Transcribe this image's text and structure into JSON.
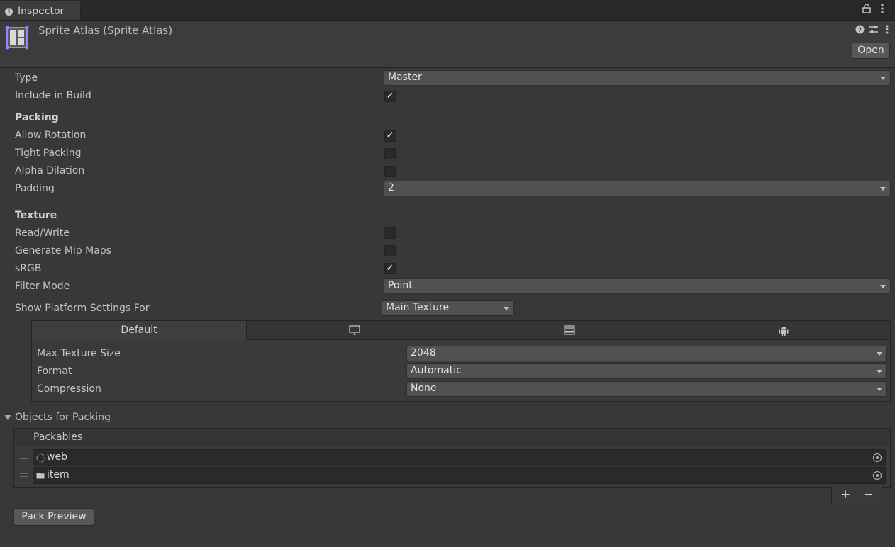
{
  "window": {
    "tab_label": "Inspector",
    "tab_icon": "info-icon",
    "lock_icon": "lock-icon",
    "menu_icon": "kebab-menu-icon"
  },
  "header": {
    "asset_title": "Sprite Atlas (Sprite Atlas)",
    "asset_icon": "sprite-atlas-icon",
    "open_button": "Open",
    "help_icon": "help-icon",
    "preset_icon": "preset-icon",
    "menu_icon": "kebab-menu-icon"
  },
  "fields": {
    "type": {
      "label": "Type",
      "value": "Master"
    },
    "include_in_build": {
      "label": "Include in Build",
      "checked": true
    },
    "packing_header": "Packing",
    "allow_rotation": {
      "label": "Allow Rotation",
      "checked": true
    },
    "tight_packing": {
      "label": "Tight Packing",
      "checked": false
    },
    "alpha_dilation": {
      "label": "Alpha Dilation",
      "checked": false
    },
    "padding": {
      "label": "Padding",
      "value": "2"
    },
    "texture_header": "Texture",
    "read_write": {
      "label": "Read/Write",
      "checked": false
    },
    "generate_mip_maps": {
      "label": "Generate Mip Maps",
      "checked": false
    },
    "srgb": {
      "label": "sRGB",
      "checked": true
    },
    "filter_mode": {
      "label": "Filter Mode",
      "value": "Point"
    },
    "platform_settings_for": {
      "label": "Show Platform Settings For",
      "value": "Main Texture"
    }
  },
  "platform_tabs": [
    {
      "label": "Default",
      "icon": ""
    },
    {
      "label": "",
      "icon": "monitor-icon"
    },
    {
      "label": "",
      "icon": "server-icon"
    },
    {
      "label": "",
      "icon": "android-icon"
    }
  ],
  "platform_settings": {
    "max_texture_size": {
      "label": "Max Texture Size",
      "value": "2048"
    },
    "format": {
      "label": "Format",
      "value": "Automatic"
    },
    "compression": {
      "label": "Compression",
      "value": "None"
    }
  },
  "objects_for_packing": {
    "label": "Objects for Packing",
    "list_header": "Packables",
    "items": [
      {
        "name": "web",
        "icon": "sprite-icon"
      },
      {
        "name": "item",
        "icon": "folder-icon"
      }
    ],
    "add_label": "+",
    "remove_label": "−"
  },
  "pack_preview_button": "Pack Preview",
  "colors": {
    "background": "#383838",
    "accent_icon": "#a27eff"
  }
}
